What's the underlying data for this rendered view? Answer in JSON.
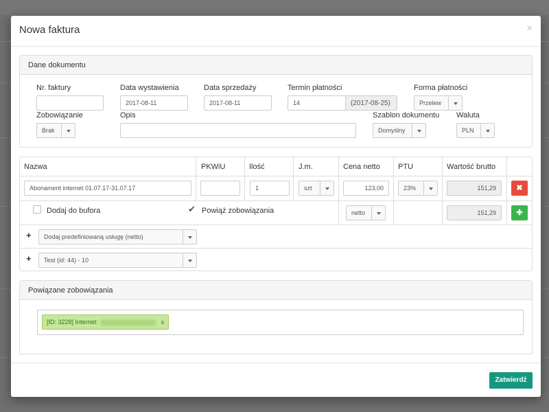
{
  "modal": {
    "title": "Nowa faktura",
    "close_label": "×"
  },
  "document_panel": {
    "heading": "Dane dokumentu",
    "fields": {
      "invoice_number": {
        "label": "Nr. faktury",
        "value": ""
      },
      "issue_date": {
        "label": "Data wystawienia",
        "value": "2017-08-11"
      },
      "sale_date": {
        "label": "Data sprzedaży",
        "value": "2017-08-11"
      },
      "payment_term": {
        "label": "Termin płatności",
        "value": "14",
        "addon": "(2017-08-25)"
      },
      "payment_form": {
        "label": "Forma płatności",
        "value": "Przelew"
      },
      "obligation": {
        "label": "Zobowiązanie",
        "value": "Brak"
      },
      "description": {
        "label": "Opis",
        "value": ""
      },
      "template": {
        "label": "Szablon dokumentu",
        "value": "Domyślny"
      },
      "currency": {
        "label": "Waluta",
        "value": "PLN"
      }
    }
  },
  "items_table": {
    "headers": {
      "name": "Nazwa",
      "pkwiu": "PKWiU",
      "qty": "Ilość",
      "unit": "J.m.",
      "net_price": "Cena netto",
      "vat": "PTU",
      "gross": "Wartość brutto"
    },
    "row": {
      "name": "Abonament internet 01.07.17-31.07.17",
      "pkwiu": "",
      "qty": "1",
      "unit": "szt",
      "net_price": "123,00",
      "vat": "23%",
      "gross": "151,29",
      "remove_icon": "✖"
    },
    "summary": {
      "add_to_buffer_label": "Dodaj do bufora",
      "link_obligations_label": "Powiąż zobowiązania",
      "link_obligations_checked": true,
      "price_mode": "netto",
      "gross_total": "151,29",
      "add_icon": "✚"
    },
    "predefined_service": {
      "plus": "+",
      "placeholder": "Dodaj predefiniowaną usługę (netto)"
    },
    "test_select": {
      "plus": "+",
      "value": "Test (id: 44) - 10"
    }
  },
  "linked_panel": {
    "heading": "Powiązane zobowiązania",
    "tag_prefix": "[ID: 3228] Internet:",
    "tag_remove": "x"
  },
  "footer": {
    "submit_label": "Zatwierdź"
  },
  "colors": {
    "primary": "#16987e",
    "danger": "#e74c3c",
    "success": "#3ab54a",
    "tag_bg": "#c6e79c"
  }
}
